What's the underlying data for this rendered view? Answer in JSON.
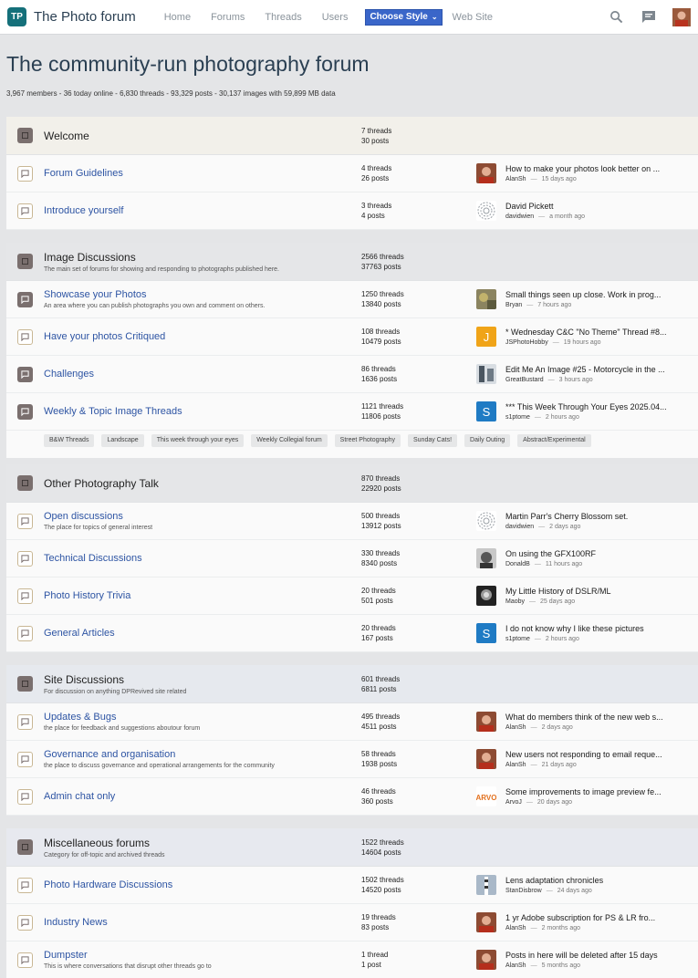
{
  "header": {
    "logo_text": "TP",
    "site_title": "The Photo forum",
    "nav": [
      "Home",
      "Forums",
      "Threads",
      "Users"
    ],
    "style_button": "Choose Style",
    "web_site": "Web Site"
  },
  "page": {
    "title": "The community-run photography forum",
    "stats": "3,967 members - 36 today online - 6,830 threads - 93,329 posts - 30,137 images with 59,899 MB data"
  },
  "categories": [
    {
      "name": "Welcome",
      "description": "",
      "threads": "7 threads",
      "posts": "30 posts",
      "forums": [
        {
          "name": "Forum Guidelines",
          "description": "",
          "icon_state": "read",
          "threads": "4 threads",
          "posts": "26 posts",
          "last_title": "How to make your photos look better on ...",
          "last_user": "AlanSh",
          "last_time": "15 days ago",
          "avatar": "alan"
        },
        {
          "name": "Introduce yourself",
          "description": "",
          "icon_state": "read",
          "threads": "3 threads",
          "posts": "4 posts",
          "last_title": "David Pickett",
          "last_user": "davidwien",
          "last_time": "a month ago",
          "avatar": "fingerprint"
        }
      ],
      "tags": []
    },
    {
      "name": "Image Discussions",
      "description": "The main set of forums for showing and responding to photographs published here.",
      "threads": "2566 threads",
      "posts": "37763 posts",
      "forums": [
        {
          "name": "Showcase your Photos",
          "description": "An area where you can publish photographs you own and comment on others.",
          "icon_state": "unread",
          "threads": "1250 threads",
          "posts": "13840 posts",
          "last_title": "Small things seen up close. Work in prog...",
          "last_user": "Bryan",
          "last_time": "7 hours ago",
          "avatar": "bryan"
        },
        {
          "name": "Have your photos Critiqued",
          "description": "",
          "icon_state": "read",
          "threads": "108 threads",
          "posts": "10479 posts",
          "last_title": "* Wednesday C&C \"No Theme\" Thread #8...",
          "last_user": "JSPhotoHobby",
          "last_time": "19 hours ago",
          "avatar": "letter-j"
        },
        {
          "name": "Challenges",
          "description": "",
          "icon_state": "unread",
          "threads": "86 threads",
          "posts": "1636 posts",
          "last_title": "Edit Me An Image #25 - Motorcycle in the ...",
          "last_user": "GreatBustard",
          "last_time": "3 hours ago",
          "avatar": "bustard"
        },
        {
          "name": "Weekly & Topic Image Threads",
          "description": "",
          "icon_state": "unread",
          "threads": "1121 threads",
          "posts": "11806 posts",
          "last_title": "*** This Week Through Your Eyes 2025.04...",
          "last_user": "s1ptome",
          "last_time": "2 hours ago",
          "avatar": "letter-s"
        }
      ],
      "tags": [
        "B&W Threads",
        "Landscape",
        "This week through your eyes",
        "Weekly Collegial forum",
        "Street Photography",
        "Sunday Cats!",
        "Daily Outing",
        "Abstract/Experimental"
      ]
    },
    {
      "name": "Other Photography Talk",
      "description": "",
      "threads": "870 threads",
      "posts": "22920 posts",
      "forums": [
        {
          "name": "Open discussions",
          "description": "The place for topics of general interest",
          "icon_state": "read",
          "threads": "500 threads",
          "posts": "13912 posts",
          "last_title": "Martin Parr's Cherry Blossom set.",
          "last_user": "davidwien",
          "last_time": "2 days ago",
          "avatar": "fingerprint"
        },
        {
          "name": "Technical Discussions",
          "description": "",
          "icon_state": "read",
          "threads": "330 threads",
          "posts": "8340 posts",
          "last_title": "On using the GFX100RF",
          "last_user": "DonaldB",
          "last_time": "11 hours ago",
          "avatar": "donald"
        },
        {
          "name": "Photo History Trivia",
          "description": "",
          "icon_state": "read",
          "threads": "20 threads",
          "posts": "501 posts",
          "last_title": "My Little History of DSLR/ML",
          "last_user": "Maoby",
          "last_time": "25 days ago",
          "avatar": "maoby"
        },
        {
          "name": "General Articles",
          "description": "",
          "icon_state": "read",
          "threads": "20 threads",
          "posts": "167 posts",
          "last_title": "I do not know why I like these pictures",
          "last_user": "s1ptome",
          "last_time": "2 hours ago",
          "avatar": "letter-s"
        }
      ],
      "tags": []
    },
    {
      "name": "Site Discussions",
      "description": "For discussion on anything DPRevived site related",
      "threads": "601 threads",
      "posts": "6811 posts",
      "forums": [
        {
          "name": "Updates & Bugs",
          "description": "the place for feedback and suggestions aboutour forum",
          "icon_state": "read",
          "threads": "495 threads",
          "posts": "4511 posts",
          "last_title": "What do members think of the new web s...",
          "last_user": "AlanSh",
          "last_time": "2 days ago",
          "avatar": "alan"
        },
        {
          "name": "Governance and organisation",
          "description": "the place to discuss governance and operational arrangements for the community",
          "icon_state": "read",
          "threads": "58 threads",
          "posts": "1938 posts",
          "last_title": "New users not responding to email reque...",
          "last_user": "AlanSh",
          "last_time": "21 days ago",
          "avatar": "alan"
        },
        {
          "name": "Admin chat only",
          "description": "",
          "icon_state": "read",
          "threads": "46 threads",
          "posts": "360 posts",
          "last_title": "Some improvements to image preview fe...",
          "last_user": "ArvoJ",
          "last_time": "20 days ago",
          "avatar": "arvo"
        }
      ],
      "tags": []
    },
    {
      "name": "Miscellaneous forums",
      "description": "Category for off-topic and archived threads",
      "threads": "1522 threads",
      "posts": "14604 posts",
      "forums": [
        {
          "name": "Photo Hardware Discussions",
          "description": "",
          "icon_state": "read",
          "threads": "1502 threads",
          "posts": "14520 posts",
          "last_title": "Lens adaptation chronicles",
          "last_user": "StanDisbrow",
          "last_time": "24 days ago",
          "avatar": "stan"
        },
        {
          "name": "Industry News",
          "description": "",
          "icon_state": "read",
          "threads": "19 threads",
          "posts": "83 posts",
          "last_title": "1 yr Adobe subscription for PS & LR fro...",
          "last_user": "AlanSh",
          "last_time": "2 months ago",
          "avatar": "alan"
        },
        {
          "name": "Dumpster",
          "description": "This is where conversations that disrupt other threads go to",
          "icon_state": "read",
          "threads": "1 thread",
          "posts": "1 post",
          "last_title": "Posts in here will be deleted after 15 days",
          "last_user": "AlanSh",
          "last_time": "5 months ago",
          "avatar": "alan"
        }
      ],
      "tags": []
    }
  ],
  "colors": {
    "accent": "#3a66c9",
    "link": "#2d54a3",
    "title": "#2a3f52",
    "letter_j": "#f0a418",
    "letter_s": "#1f7bc4",
    "arvo": "#e2701e"
  }
}
